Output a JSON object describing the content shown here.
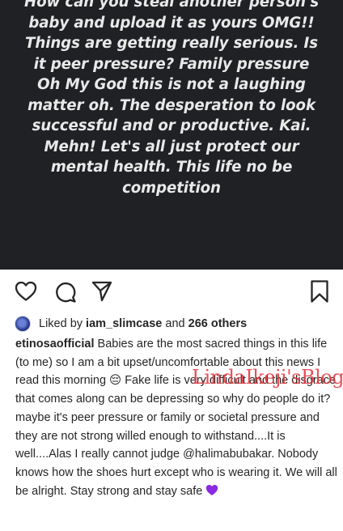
{
  "post_image": {
    "lines": [
      "How can you steal another person's",
      "baby and upload it as yours OMG!!",
      "Things are getting really serious. Is",
      "it peer pressure? Family pressure",
      "Oh My God this is not a laughing",
      "matter oh. The desperation to look",
      "successful and or productive. Kai.",
      "Mehn! Let's all just protect our",
      "mental health. This life no be",
      "competition"
    ]
  },
  "actions": {
    "like_icon": "heart-outline",
    "comment_icon": "speech-bubble",
    "share_icon": "paper-plane",
    "save_icon": "bookmark"
  },
  "likes": {
    "prefix": "Liked by ",
    "user": "iam_slimcase",
    "middle": " and ",
    "count": "266 others"
  },
  "caption": {
    "username": "etinosaofficial",
    "text_part1": " Babies are the most sacred things in this life (to me) so I am a bit upset/uncomfortable about this news I read this morning 😔 Fake life is very difficult and the disgrace that comes along can be depressing so why do people do it? maybe it's peer pressure or family or societal pressure and they are not strong willed enough to withstand....It is well....Alas I really cannot judge ",
    "mention": "@halimabubakar",
    "text_part2": ". Nobody knows how the shoes hurt except who is wearing it. We will all be alright. Stay strong and stay safe ",
    "emoji": "purple-heart"
  },
  "watermark": {
    "text": "LindaIkeji'sBlog",
    "color": "#e5333a"
  }
}
